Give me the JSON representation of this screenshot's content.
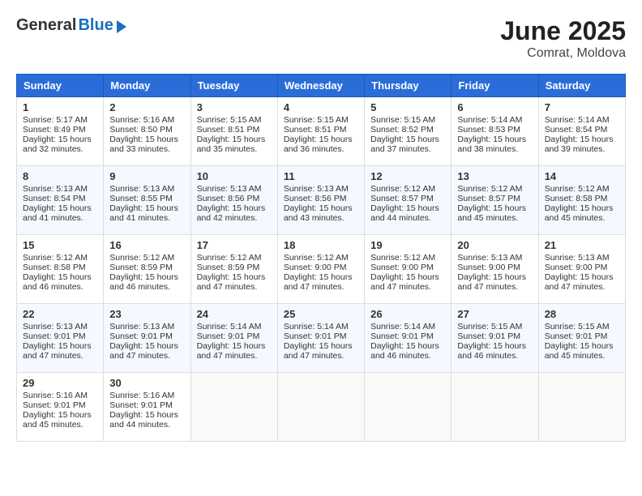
{
  "header": {
    "logo_general": "General",
    "logo_blue": "Blue",
    "month_title": "June 2025",
    "location": "Comrat, Moldova"
  },
  "weekdays": [
    "Sunday",
    "Monday",
    "Tuesday",
    "Wednesday",
    "Thursday",
    "Friday",
    "Saturday"
  ],
  "weeks": [
    [
      {
        "day": "1",
        "sunrise": "Sunrise: 5:17 AM",
        "sunset": "Sunset: 8:49 PM",
        "daylight": "Daylight: 15 hours and 32 minutes."
      },
      {
        "day": "2",
        "sunrise": "Sunrise: 5:16 AM",
        "sunset": "Sunset: 8:50 PM",
        "daylight": "Daylight: 15 hours and 33 minutes."
      },
      {
        "day": "3",
        "sunrise": "Sunrise: 5:15 AM",
        "sunset": "Sunset: 8:51 PM",
        "daylight": "Daylight: 15 hours and 35 minutes."
      },
      {
        "day": "4",
        "sunrise": "Sunrise: 5:15 AM",
        "sunset": "Sunset: 8:51 PM",
        "daylight": "Daylight: 15 hours and 36 minutes."
      },
      {
        "day": "5",
        "sunrise": "Sunrise: 5:15 AM",
        "sunset": "Sunset: 8:52 PM",
        "daylight": "Daylight: 15 hours and 37 minutes."
      },
      {
        "day": "6",
        "sunrise": "Sunrise: 5:14 AM",
        "sunset": "Sunset: 8:53 PM",
        "daylight": "Daylight: 15 hours and 38 minutes."
      },
      {
        "day": "7",
        "sunrise": "Sunrise: 5:14 AM",
        "sunset": "Sunset: 8:54 PM",
        "daylight": "Daylight: 15 hours and 39 minutes."
      }
    ],
    [
      {
        "day": "8",
        "sunrise": "Sunrise: 5:13 AM",
        "sunset": "Sunset: 8:54 PM",
        "daylight": "Daylight: 15 hours and 41 minutes."
      },
      {
        "day": "9",
        "sunrise": "Sunrise: 5:13 AM",
        "sunset": "Sunset: 8:55 PM",
        "daylight": "Daylight: 15 hours and 41 minutes."
      },
      {
        "day": "10",
        "sunrise": "Sunrise: 5:13 AM",
        "sunset": "Sunset: 8:56 PM",
        "daylight": "Daylight: 15 hours and 42 minutes."
      },
      {
        "day": "11",
        "sunrise": "Sunrise: 5:13 AM",
        "sunset": "Sunset: 8:56 PM",
        "daylight": "Daylight: 15 hours and 43 minutes."
      },
      {
        "day": "12",
        "sunrise": "Sunrise: 5:12 AM",
        "sunset": "Sunset: 8:57 PM",
        "daylight": "Daylight: 15 hours and 44 minutes."
      },
      {
        "day": "13",
        "sunrise": "Sunrise: 5:12 AM",
        "sunset": "Sunset: 8:57 PM",
        "daylight": "Daylight: 15 hours and 45 minutes."
      },
      {
        "day": "14",
        "sunrise": "Sunrise: 5:12 AM",
        "sunset": "Sunset: 8:58 PM",
        "daylight": "Daylight: 15 hours and 45 minutes."
      }
    ],
    [
      {
        "day": "15",
        "sunrise": "Sunrise: 5:12 AM",
        "sunset": "Sunset: 8:58 PM",
        "daylight": "Daylight: 15 hours and 46 minutes."
      },
      {
        "day": "16",
        "sunrise": "Sunrise: 5:12 AM",
        "sunset": "Sunset: 8:59 PM",
        "daylight": "Daylight: 15 hours and 46 minutes."
      },
      {
        "day": "17",
        "sunrise": "Sunrise: 5:12 AM",
        "sunset": "Sunset: 8:59 PM",
        "daylight": "Daylight: 15 hours and 47 minutes."
      },
      {
        "day": "18",
        "sunrise": "Sunrise: 5:12 AM",
        "sunset": "Sunset: 9:00 PM",
        "daylight": "Daylight: 15 hours and 47 minutes."
      },
      {
        "day": "19",
        "sunrise": "Sunrise: 5:12 AM",
        "sunset": "Sunset: 9:00 PM",
        "daylight": "Daylight: 15 hours and 47 minutes."
      },
      {
        "day": "20",
        "sunrise": "Sunrise: 5:13 AM",
        "sunset": "Sunset: 9:00 PM",
        "daylight": "Daylight: 15 hours and 47 minutes."
      },
      {
        "day": "21",
        "sunrise": "Sunrise: 5:13 AM",
        "sunset": "Sunset: 9:00 PM",
        "daylight": "Daylight: 15 hours and 47 minutes."
      }
    ],
    [
      {
        "day": "22",
        "sunrise": "Sunrise: 5:13 AM",
        "sunset": "Sunset: 9:01 PM",
        "daylight": "Daylight: 15 hours and 47 minutes."
      },
      {
        "day": "23",
        "sunrise": "Sunrise: 5:13 AM",
        "sunset": "Sunset: 9:01 PM",
        "daylight": "Daylight: 15 hours and 47 minutes."
      },
      {
        "day": "24",
        "sunrise": "Sunrise: 5:14 AM",
        "sunset": "Sunset: 9:01 PM",
        "daylight": "Daylight: 15 hours and 47 minutes."
      },
      {
        "day": "25",
        "sunrise": "Sunrise: 5:14 AM",
        "sunset": "Sunset: 9:01 PM",
        "daylight": "Daylight: 15 hours and 47 minutes."
      },
      {
        "day": "26",
        "sunrise": "Sunrise: 5:14 AM",
        "sunset": "Sunset: 9:01 PM",
        "daylight": "Daylight: 15 hours and 46 minutes."
      },
      {
        "day": "27",
        "sunrise": "Sunrise: 5:15 AM",
        "sunset": "Sunset: 9:01 PM",
        "daylight": "Daylight: 15 hours and 46 minutes."
      },
      {
        "day": "28",
        "sunrise": "Sunrise: 5:15 AM",
        "sunset": "Sunset: 9:01 PM",
        "daylight": "Daylight: 15 hours and 45 minutes."
      }
    ],
    [
      {
        "day": "29",
        "sunrise": "Sunrise: 5:16 AM",
        "sunset": "Sunset: 9:01 PM",
        "daylight": "Daylight: 15 hours and 45 minutes."
      },
      {
        "day": "30",
        "sunrise": "Sunrise: 5:16 AM",
        "sunset": "Sunset: 9:01 PM",
        "daylight": "Daylight: 15 hours and 44 minutes."
      },
      null,
      null,
      null,
      null,
      null
    ]
  ]
}
